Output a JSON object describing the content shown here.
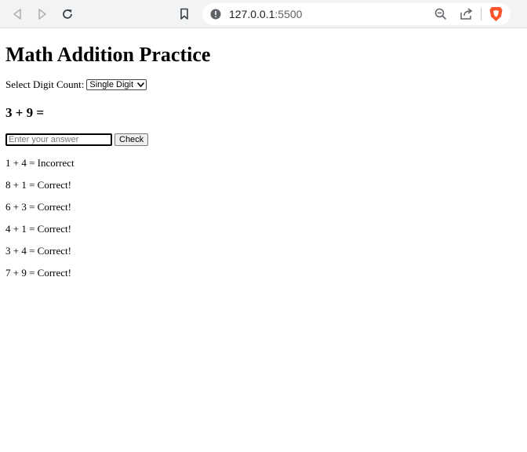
{
  "browser": {
    "url_host": "127.0.0.1",
    "url_port": ":5500",
    "brand_color": "#fb542b"
  },
  "page": {
    "title": "Math Addition Practice",
    "digit_label": "Select Digit Count:",
    "digit_selected": "Single Digit",
    "question": "3 + 9 =",
    "answer_placeholder": "Enter your answer",
    "check_label": "Check",
    "results": [
      "1 + 4 = Incorrect",
      "8 + 1 = Correct!",
      "6 + 3 = Correct!",
      "4 + 1 = Correct!",
      "3 + 4 = Correct!",
      "7 + 9 = Correct!"
    ]
  }
}
